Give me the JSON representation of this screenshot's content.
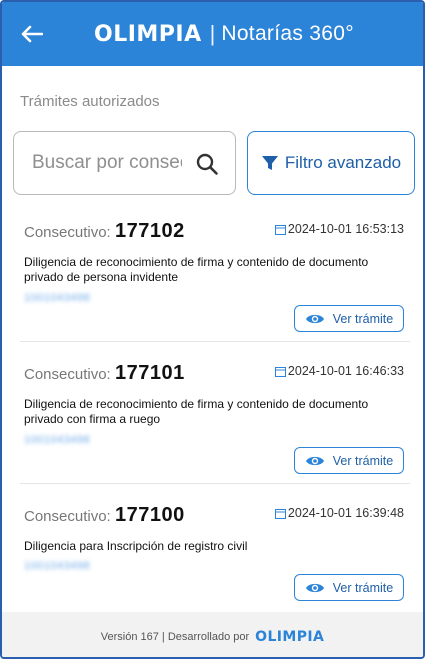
{
  "header": {
    "logo_text": "OLIMPIA",
    "separator": "|",
    "subtitle": "Notarías 360°"
  },
  "section_title": "Trámites autorizados",
  "search": {
    "placeholder": "Buscar por consecutivo",
    "value": ""
  },
  "filter_button_label": "Filtro avanzado",
  "records": [
    {
      "consecutivo_label": "Consecutivo:",
      "consecutivo": "177102",
      "datetime": "2024-10-01 16:53:13",
      "description": "Diligencia de reconocimiento de firma y contenido de documento privado de persona invidente",
      "redacted_id": "1001043498",
      "button_label": "Ver trámite"
    },
    {
      "consecutivo_label": "Consecutivo:",
      "consecutivo": "177101",
      "datetime": "2024-10-01 16:46:33",
      "description": "Diligencia de reconocimiento de firma y contenido de documento privado con firma a ruego",
      "redacted_id": "1001043498",
      "button_label": "Ver trámite"
    },
    {
      "consecutivo_label": "Consecutivo:",
      "consecutivo": "177100",
      "datetime": "2024-10-01 16:39:48",
      "description": "Diligencia para Inscripción de registro civil",
      "redacted_id": "1001043498",
      "button_label": "Ver trámite"
    }
  ],
  "footer": {
    "text": "Versión 167 | Desarrollado por",
    "logo_text": "OLIMPIA"
  },
  "colors": {
    "primary": "#2c84d8",
    "primary_dark": "#1e5fa8",
    "frame_border": "#2a5fb0"
  }
}
